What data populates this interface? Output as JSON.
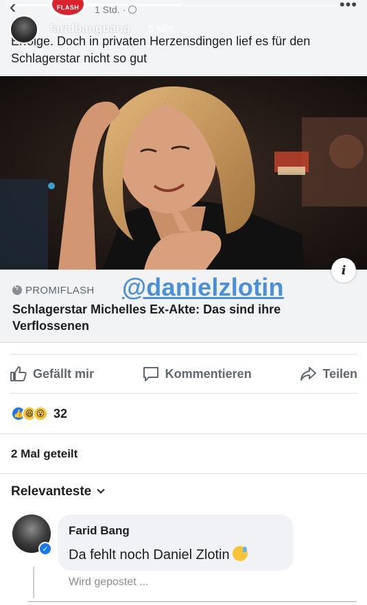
{
  "story": {
    "username": "faridbangbang",
    "age": "5 Min.",
    "mention": "@danielzlotin"
  },
  "post": {
    "time": "1 Std. ·",
    "text": "Erfolge. Doch in privaten Herzensdingen lief es für den Schlagerstar nicht so gut",
    "logo_text": "FLASH"
  },
  "link": {
    "source": "PROMIFLASH",
    "title": "Schlagerstar Michelles Ex-Akte: Das sind ihre Verflossenen",
    "info_label": "i"
  },
  "actions": {
    "like": "Gefällt mir",
    "comment": "Kommentieren",
    "share": "Teilen"
  },
  "reactions": {
    "count": "32",
    "types": [
      "like",
      "haha",
      "wow"
    ]
  },
  "shares": "2 Mal geteilt",
  "comments": {
    "sort_label": "Relevanteste",
    "items": [
      {
        "author": "Farid Bang",
        "text": "Da fehlt noch Daniel Zlotin",
        "status": "Wird gepostet ..."
      }
    ]
  },
  "colors": {
    "mention_blue": "#4a90d9",
    "facebook_blue": "#1877f2",
    "promiflash_red": "#d9232e",
    "muted_text": "#606770"
  }
}
